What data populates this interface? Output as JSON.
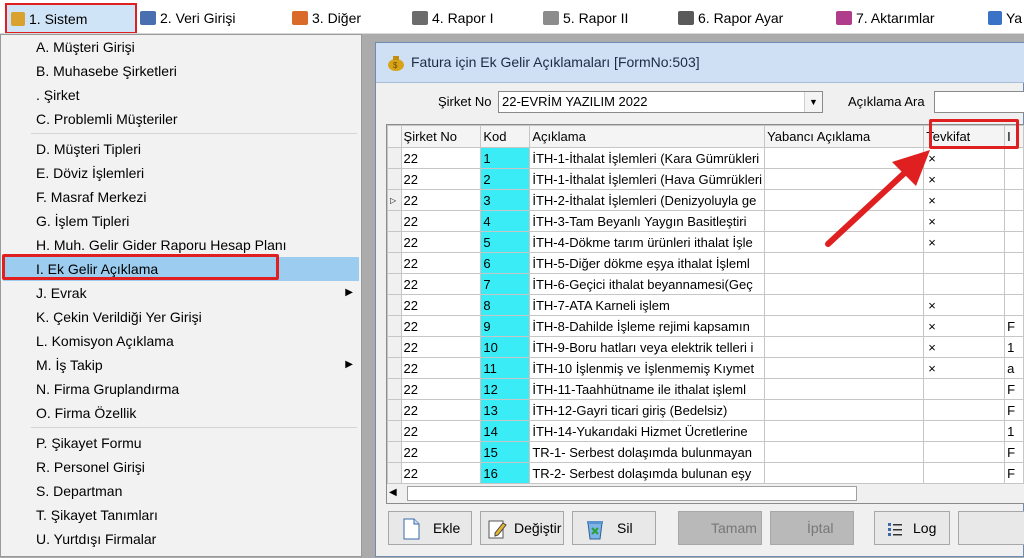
{
  "menubar": {
    "items": [
      {
        "label": "1. Sistem"
      },
      {
        "label": "2. Veri Girişi"
      },
      {
        "label": "3. Diğer"
      },
      {
        "label": "4. Rapor I"
      },
      {
        "label": "5. Rapor II"
      },
      {
        "label": "6. Rapor Ayar"
      },
      {
        "label": "7. Aktarımlar"
      },
      {
        "label": "Ya"
      }
    ]
  },
  "dropdown": {
    "items": [
      {
        "label": "A. Müşteri Girişi"
      },
      {
        "label": "B. Muhasebe Şirketleri"
      },
      {
        "label": ". Şirket"
      },
      {
        "label": "C. Problemli Müşteriler"
      },
      {
        "label": "D. Müşteri Tipleri"
      },
      {
        "label": "E. Döviz İşlemleri"
      },
      {
        "label": "F. Masraf Merkezi"
      },
      {
        "label": "G. İşlem Tipleri"
      },
      {
        "label": "H. Muh. Gelir Gider Raporu Hesap Planı"
      },
      {
        "label": "I. Ek Gelir Açıklama"
      },
      {
        "label": "J. Evrak"
      },
      {
        "label": "K. Çekin Verildiği Yer Girişi"
      },
      {
        "label": "L. Komisyon Açıklama"
      },
      {
        "label": "M. İş Takip"
      },
      {
        "label": "N. Firma Gruplandırma"
      },
      {
        "label": "O. Firma Özellik"
      },
      {
        "label": "P. Şikayet Formu"
      },
      {
        "label": "R. Personel Girişi"
      },
      {
        "label": "S. Departman"
      },
      {
        "label": "T. Şikayet Tanımları"
      },
      {
        "label": "U. Yurtdışı Firmalar"
      }
    ]
  },
  "window": {
    "title": "Fatura için Ek Gelir Açıklamaları [FormNo:503]",
    "company_label": "Şirket No",
    "company_value": "22-EVRİM YAZILIM 2022",
    "search_label": "Açıklama Ara",
    "search_value": ""
  },
  "grid": {
    "columns": [
      "Şirket No",
      "Kod",
      "Açıklama",
      "Yabancı Açıklama",
      "Tevkifat",
      "I"
    ],
    "rows": [
      {
        "sirket": "22",
        "kod": "1",
        "aciklama": "İTH-1-İthalat İşlemleri (Kara Gümrükleri",
        "yabanci": "",
        "tevkifat": "×",
        "extra": ""
      },
      {
        "sirket": "22",
        "kod": "2",
        "aciklama": "İTH-1-İthalat İşlemleri (Hava Gümrükleri",
        "yabanci": "",
        "tevkifat": "×",
        "extra": ""
      },
      {
        "sirket": "22",
        "kod": "3",
        "aciklama": "İTH-2-İthalat İşlemleri (Denizyoluyla ge",
        "yabanci": "",
        "tevkifat": "×",
        "extra": ""
      },
      {
        "sirket": "22",
        "kod": "4",
        "aciklama": "İTH-3-Tam Beyanlı Yaygın Basitleştiri",
        "yabanci": "",
        "tevkifat": "×",
        "extra": ""
      },
      {
        "sirket": "22",
        "kod": "5",
        "aciklama": "İTH-4-Dökme tarım ürünleri ithalat İşle",
        "yabanci": "",
        "tevkifat": "×",
        "extra": ""
      },
      {
        "sirket": "22",
        "kod": "6",
        "aciklama": "İTH-5-Diğer dökme eşya ithalat İşleml",
        "yabanci": "",
        "tevkifat": "",
        "extra": ""
      },
      {
        "sirket": "22",
        "kod": "7",
        "aciklama": "İTH-6-Geçici ithalat beyannamesi(Geç",
        "yabanci": "",
        "tevkifat": "",
        "extra": ""
      },
      {
        "sirket": "22",
        "kod": "8",
        "aciklama": "İTH-7-ATA Karneli işlem",
        "yabanci": "",
        "tevkifat": "×",
        "extra": ""
      },
      {
        "sirket": "22",
        "kod": "9",
        "aciklama": "İTH-8-Dahilde İşleme rejimi kapsamın",
        "yabanci": "",
        "tevkifat": "×",
        "extra": "F"
      },
      {
        "sirket": "22",
        "kod": "10",
        "aciklama": "İTH-9-Boru hatları veya elektrik telleri i",
        "yabanci": "",
        "tevkifat": "×",
        "extra": "1"
      },
      {
        "sirket": "22",
        "kod": "11",
        "aciklama": "İTH-10 İşlenmiş ve İşlenmemiş Kıymet",
        "yabanci": "",
        "tevkifat": "×",
        "extra": "a"
      },
      {
        "sirket": "22",
        "kod": "12",
        "aciklama": "İTH-11-Taahhütname ile ithalat işleml",
        "yabanci": "",
        "tevkifat": "",
        "extra": "F"
      },
      {
        "sirket": "22",
        "kod": "13",
        "aciklama": "İTH-12-Gayri ticari giriş (Bedelsiz)",
        "yabanci": "",
        "tevkifat": "",
        "extra": "F"
      },
      {
        "sirket": "22",
        "kod": "14",
        "aciklama": "İTH-14-Yukarıdaki Hizmet Ücretlerine",
        "yabanci": "",
        "tevkifat": "",
        "extra": "1"
      },
      {
        "sirket": "22",
        "kod": "15",
        "aciklama": "TR-1- Serbest dolaşımda bulunmayan",
        "yabanci": "",
        "tevkifat": "",
        "extra": "F"
      },
      {
        "sirket": "22",
        "kod": "16",
        "aciklama": "TR-2- Serbest dolaşımda bulunan eşy",
        "yabanci": "",
        "tevkifat": "",
        "extra": "F"
      }
    ]
  },
  "toolbar": {
    "ekle": "Ekle",
    "degistir": "Değiştir",
    "sil": "Sil",
    "tamam": "Tamam",
    "iptal": "İptal",
    "log": "Log"
  },
  "colors": {
    "highlight": "#e02020",
    "kod_column": "#39ecf5",
    "menu_selected": "#9ccdf0"
  }
}
